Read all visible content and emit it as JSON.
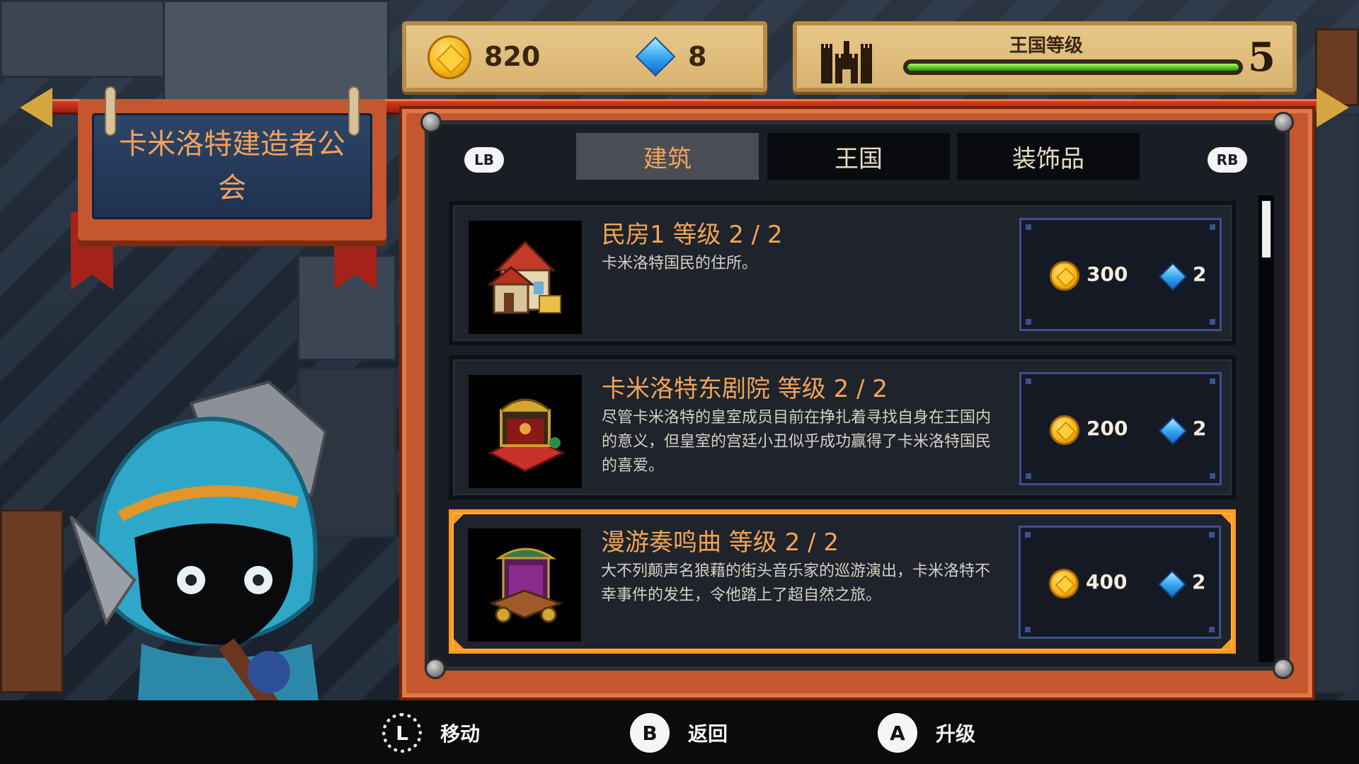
{
  "resources": {
    "coins": "820",
    "gems": "8"
  },
  "kingdom": {
    "label": "王国等级",
    "level": "5",
    "progress": 1.0
  },
  "guild": {
    "title": "卡米洛特建造者公会"
  },
  "tabs": {
    "left_shoulder": "LB",
    "right_shoulder": "RB",
    "items": [
      {
        "label": "建筑",
        "active": true
      },
      {
        "label": "王国",
        "active": false
      },
      {
        "label": "装饰品",
        "active": false
      }
    ]
  },
  "buildings": [
    {
      "title": "民房1 等级 2 / 2",
      "description": "卡米洛特国民的住所。",
      "cost_coins": "300",
      "cost_gems": "2",
      "selected": false
    },
    {
      "title": "卡米洛特东剧院 等级 2 / 2",
      "description": "尽管卡米洛特的皇室成员目前在挣扎着寻找自身在王国内的意义，但皇室的宫廷小丑似乎成功赢得了卡米洛特国民的喜爱。",
      "cost_coins": "200",
      "cost_gems": "2",
      "selected": false
    },
    {
      "title": "漫游奏鸣曲 等级 2 / 2",
      "description": "大不列颠声名狼藉的街头音乐家的巡游演出，卡米洛特不幸事件的发生，令他踏上了超自然之旅。",
      "cost_coins": "400",
      "cost_gems": "2",
      "selected": true
    }
  ],
  "prompts": [
    {
      "button": "L",
      "label": "移动",
      "icon": "left-stick-icon"
    },
    {
      "button": "B",
      "label": "返回",
      "icon": "b-button-icon"
    },
    {
      "button": "A",
      "label": "升级",
      "icon": "a-button-icon"
    }
  ],
  "colors": {
    "accent_orange": "#f0a458",
    "selection": "#ff9a1f",
    "panel_frame": "#c4572d",
    "level_green": "#4fc41c"
  }
}
